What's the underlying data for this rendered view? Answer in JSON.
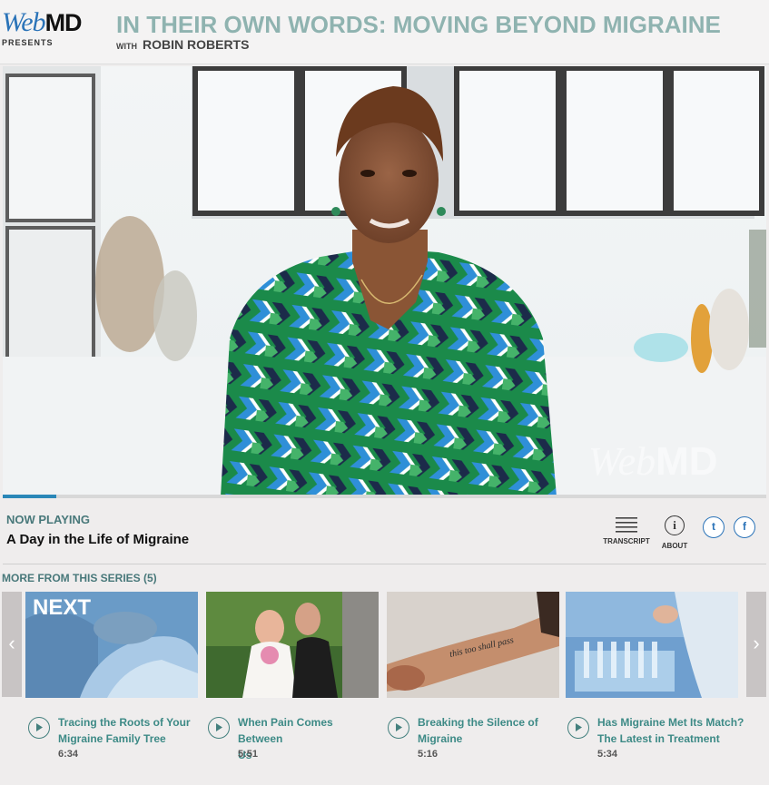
{
  "brand": {
    "logo_web": "Web",
    "logo_md": "MD",
    "presents": "PRESENTS"
  },
  "series": {
    "title": "IN THEIR OWN WORDS: MOVING BEYOND MIGRAINE",
    "with_label": "WITH",
    "host": "ROBIN ROBERTS"
  },
  "player": {
    "watermark_web": "Web",
    "watermark_md": "MD",
    "progress_fraction": 0.07
  },
  "now_playing": {
    "label": "NOW PLAYING",
    "title": "A Day in the Life of Migraine"
  },
  "tools": {
    "transcript": "TRANSCRIPT",
    "about": "ABOUT",
    "about_glyph": "i"
  },
  "social": {
    "twitter": "t",
    "facebook": "f"
  },
  "more": {
    "label": "MORE FROM THIS SERIES (5)",
    "next_badge": "NEXT",
    "prev_arrow": "‹",
    "next_arrow": "›",
    "items": [
      {
        "title_line1": "Tracing the Roots of Your",
        "title_line2": "Migraine Family Tree",
        "duration": "6:34"
      },
      {
        "title_line1": "When Pain Comes Between",
        "title_line2": "Us",
        "duration": "5:51"
      },
      {
        "title_line1": "Breaking the Silence of",
        "title_line2": "Migraine",
        "duration": "5:16"
      },
      {
        "title_line1": "Has Migraine Met Its Match?",
        "title_line2": "The Latest in Treatment",
        "duration": "5:34"
      }
    ],
    "tattoo_text": "this too shall pass"
  },
  "colors": {
    "accent_teal": "#48787a",
    "link_teal": "#3d8a86",
    "title_teal": "#8fb3b0",
    "brand_blue": "#2a73b8"
  }
}
